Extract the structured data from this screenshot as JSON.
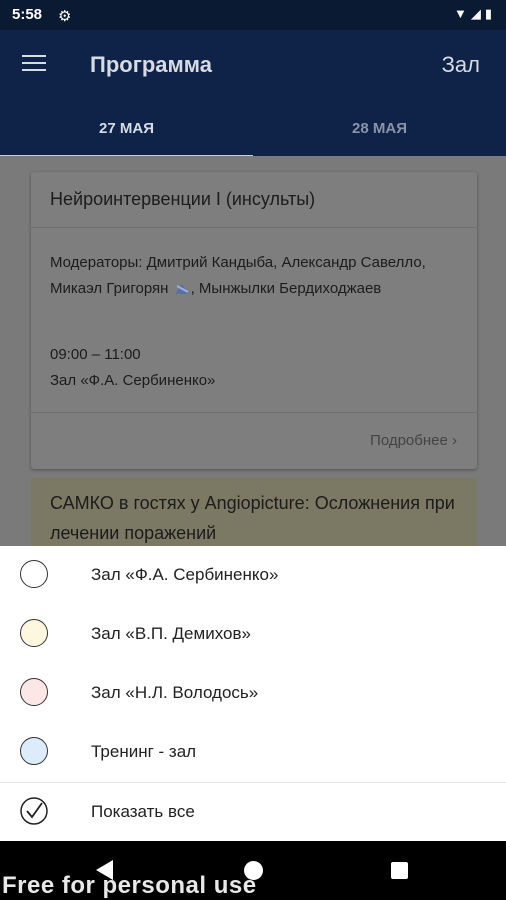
{
  "status": {
    "time": "5:58",
    "icons": "▼◢▮"
  },
  "appbar": {
    "title": "Программа",
    "hall_button": "Зал"
  },
  "tabs": [
    {
      "label": "27 МАЯ"
    },
    {
      "label": "28 МАЯ"
    }
  ],
  "card": {
    "title": "Нейроинтервенции I (инсульты)",
    "moderators_a": "Модераторы: Дмитрий Кандыба, Александр Савелло, Микаэл Григорян",
    "moderators_b": ", Мынжылки Бердиходжаев",
    "time": "09:00 – 11:00",
    "place": "Зал «Ф.А. Сербиненко»",
    "more": "Подробнее"
  },
  "card2": {
    "title": "САМКО в гостях у Angiopicture: Осложнения при лечении поражений"
  },
  "filter": {
    "items": [
      {
        "label": "Зал «Ф.А. Сербиненко»",
        "color": "#ffffff"
      },
      {
        "label": "Зал «В.П. Демихов»",
        "color": "#fdf7e0"
      },
      {
        "label": "Зал «Н.Л. Володось»",
        "color": "#fde7e6"
      },
      {
        "label": "Тренинг - зал",
        "color": "#dcecfb"
      }
    ],
    "show_all": "Показать все"
  },
  "watermark": "Free for personal use"
}
